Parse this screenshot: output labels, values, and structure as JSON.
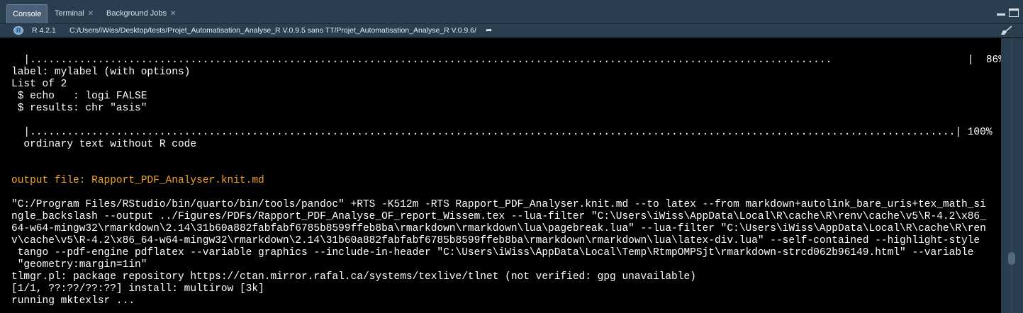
{
  "tabs": [
    {
      "label": "Console",
      "active": true,
      "closable": false
    },
    {
      "label": "Terminal",
      "active": false,
      "closable": true
    },
    {
      "label": "Background Jobs",
      "active": false,
      "closable": true
    }
  ],
  "pathbar": {
    "r_version": "R 4.2.1",
    "path": "C:/Users/iWiss/Desktop/tests/Projet_Automatisation_Analyse_R V.0.9.5 sans TT/Projet_Automatisation_Analyse_R V.0.9.6/"
  },
  "icons": {
    "r_logo": "r-logo-icon",
    "goto": "arrow-right-icon",
    "clear": "broom-icon",
    "minimize": "minimize-icon",
    "maximize": "maximize-icon",
    "close": "close-icon"
  },
  "colors": {
    "tabbar_bg": "#2b3e50",
    "console_bg": "#000000",
    "console_text": "#ffffff",
    "highlight_text": "#f0a22a"
  },
  "console": {
    "lines": [
      "  ordinary text without R code",
      "  |..................................................................................................................................                      |  86%",
      "label: mylabel (with options)",
      "List of 2",
      " $ echo   : logi FALSE",
      " $ results: chr \"asis\"",
      "  |......................................................................................................................................................| 100%",
      "  ordinary text without R code",
      "output file: Rapport_PDF_Analyser.knit.md",
      "\"C:/Program Files/RStudio/bin/quarto/bin/tools/pandoc\" +RTS -K512m -RTS Rapport_PDF_Analyser.knit.md --to latex --from markdown+autolink_bare_uris+tex_math_si",
      "ngle_backslash --output ../Figures/PDFs/Rapport_PDF_Analyse_OF_report_Wissem.tex --lua-filter \"C:\\Users\\iWiss\\AppData\\Local\\R\\cache\\R\\renv\\cache\\v5\\R-4.2\\x86_",
      "64-w64-mingw32\\rmarkdown\\2.14\\31b60a882fabfabf6785b8599ffeb8ba\\rmarkdown\\rmarkdown\\lua\\pagebreak.lua\" --lua-filter \"C:\\Users\\iWiss\\AppData\\Local\\R\\cache\\R\\ren",
      "v\\cache\\v5\\R-4.2\\x86_64-w64-mingw32\\rmarkdown\\2.14\\31b60a882fabfabf6785b8599ffeb8ba\\rmarkdown\\rmarkdown\\lua\\latex-div.lua\" --self-contained --highlight-style",
      " tango --pdf-engine pdflatex --variable graphics --include-in-header \"C:\\Users\\iWiss\\AppData\\Local\\Temp\\RtmpOMPSjt\\rmarkdown-strcd062b96149.html\" --variable",
      " \"geometry:margin=1in\"",
      "tlmgr.pl: package repository https://ctan.mirror.rafal.ca/systems/texlive/tlnet (not verified: gpg unavailable)",
      "[1/1, ??:??/??:??] install: multirow [3k]",
      "running mktexlsr ..."
    ]
  }
}
